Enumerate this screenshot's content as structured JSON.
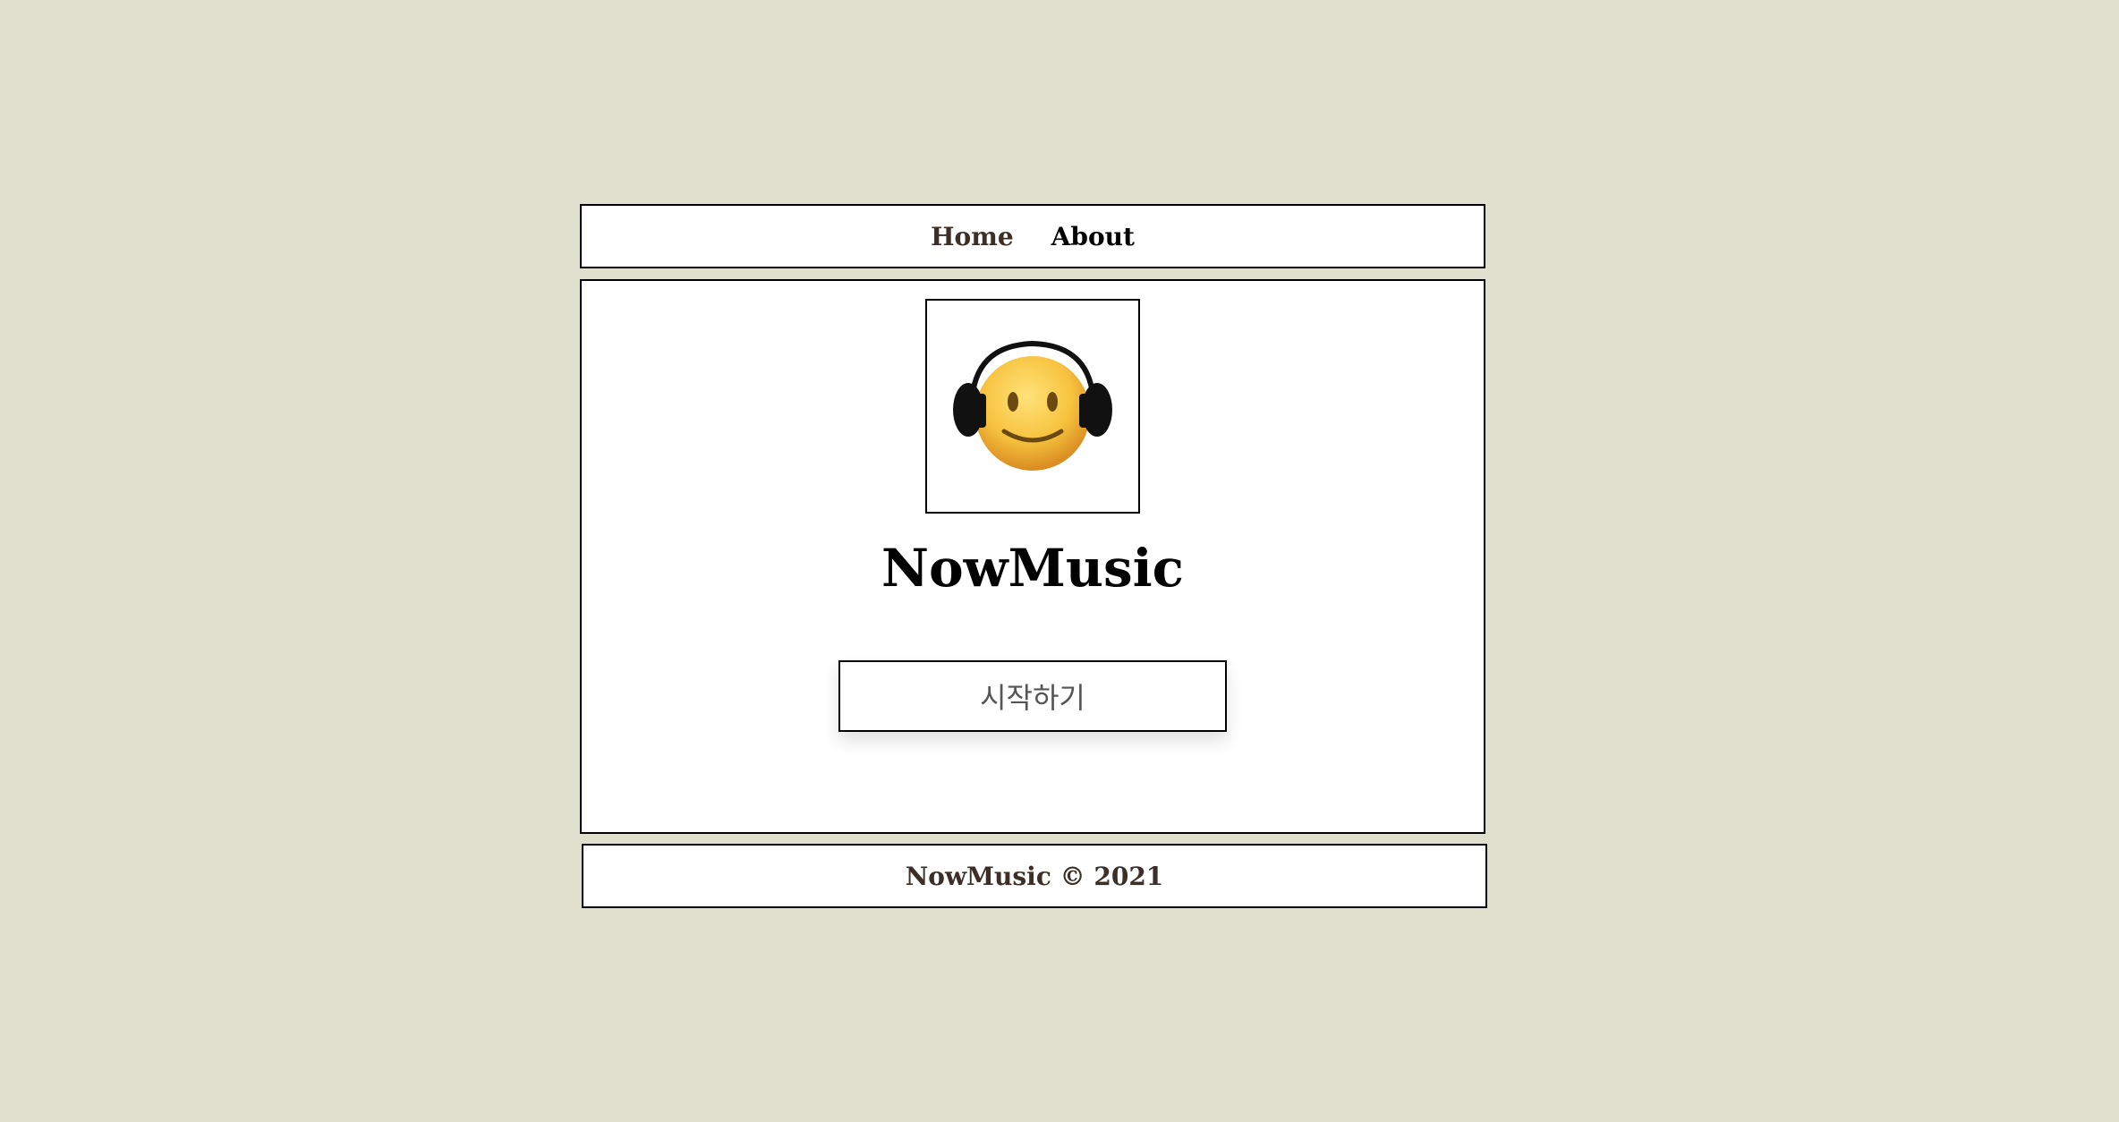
{
  "nav": {
    "items": [
      {
        "label": "Home"
      },
      {
        "label": "About"
      }
    ]
  },
  "main": {
    "logo_icon": "headphones-smiley-icon",
    "title": "NowMusic",
    "start_button": "시작하기"
  },
  "footer": {
    "text": "NowMusic © 2021"
  },
  "colors": {
    "background": "#dedfcc",
    "panel": "#ffffff",
    "border": "#000000",
    "nav_home": "#3b2f27"
  }
}
